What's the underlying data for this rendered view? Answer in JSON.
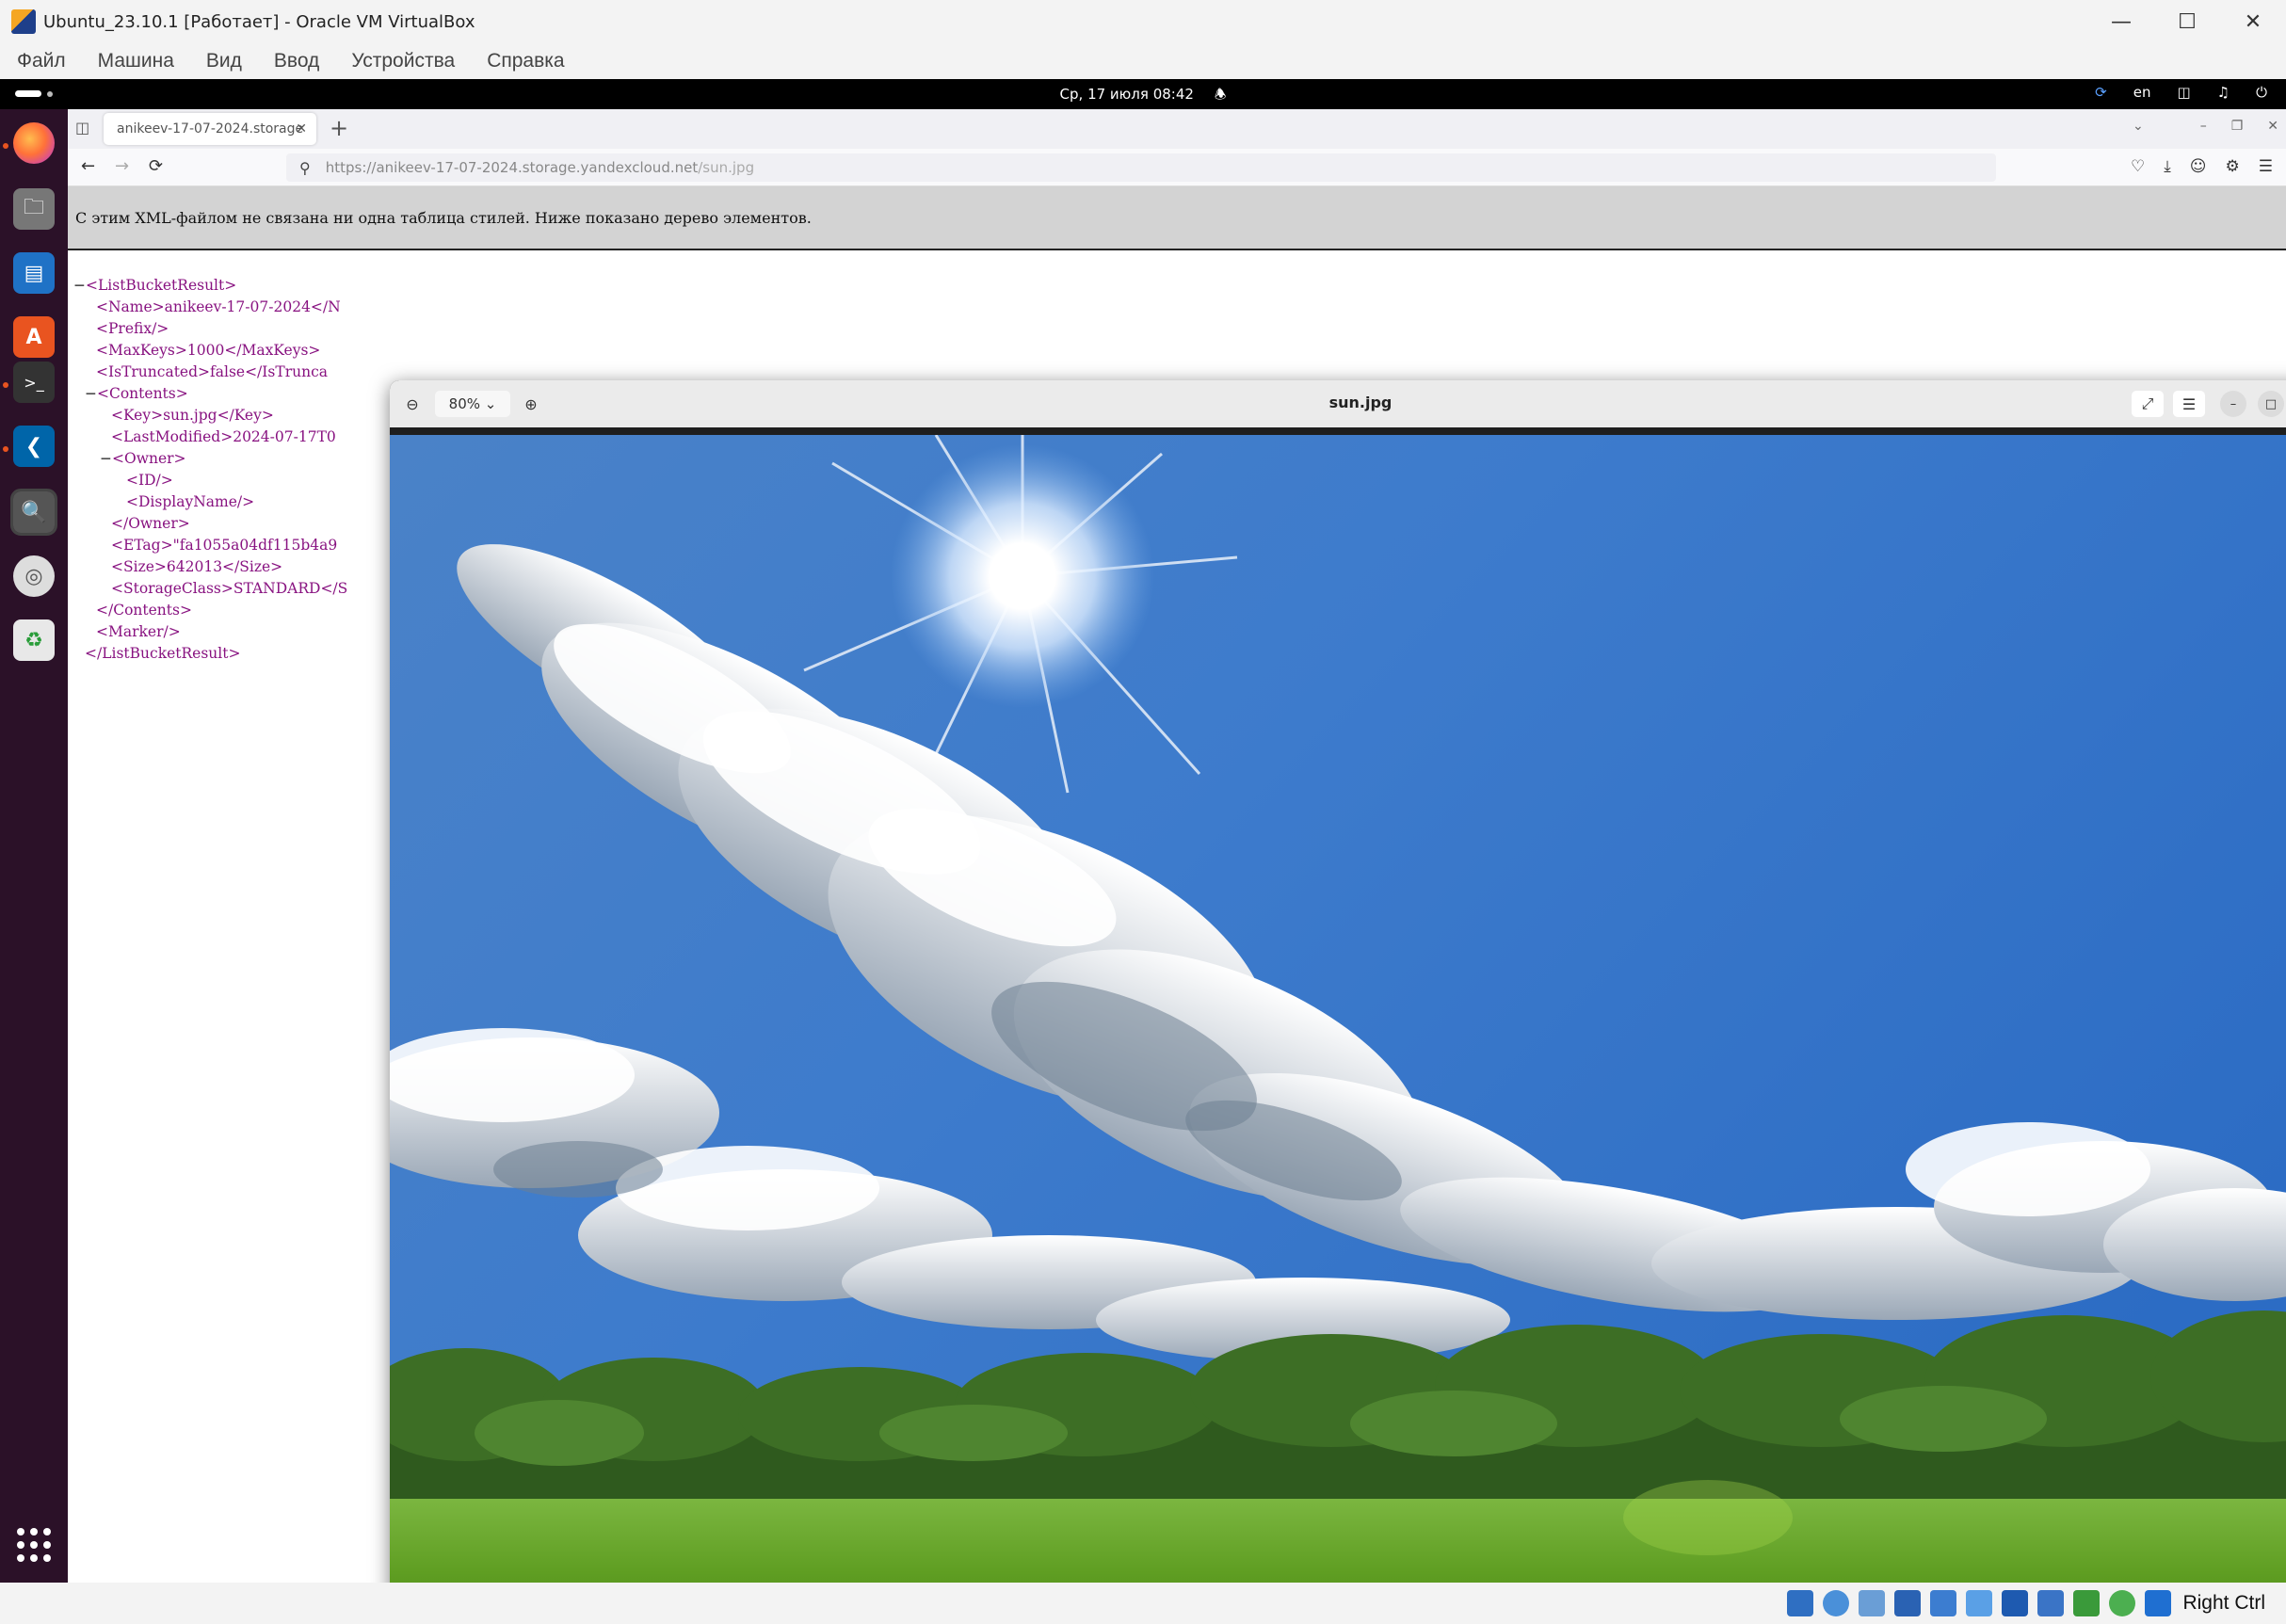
{
  "host_window": {
    "title": "Ubuntu_23.10.1 [Работает] - Oracle VM VirtualBox",
    "menu": [
      "Файл",
      "Машина",
      "Вид",
      "Ввод",
      "Устройства",
      "Справка"
    ],
    "host_key_label": "Right Ctrl"
  },
  "topbar": {
    "datetime": "Ср, 17 июля  08:42",
    "keyboard_layout": "en"
  },
  "browser": {
    "tab_title": "anikeev-17-07-2024.storage",
    "url_host": "https://anikeev-17-07-2024.storage.yandexcloud.net",
    "url_path": "/sun.jpg",
    "xml_notice": "С этим XML-файлом не связана ни одна таблица стилей. Ниже показано дерево элементов."
  },
  "xml_tree": [
    {
      "toggle": "−",
      "text": "<ListBucketResult>"
    },
    {
      "toggle": "",
      "text": "<Name>anikeev-17-07-2024</N"
    },
    {
      "toggle": "",
      "text": "<Prefix/>"
    },
    {
      "toggle": "",
      "text": "<MaxKeys>1000</MaxKeys>"
    },
    {
      "toggle": "",
      "text": "<IsTruncated>false</IsTrunca"
    },
    {
      "toggle": "−",
      "text": "<Contents>"
    },
    {
      "toggle": "",
      "text": "<Key>sun.jpg</Key>"
    },
    {
      "toggle": "",
      "text": "<LastModified>2024-07-17T0"
    },
    {
      "toggle": "−",
      "text": "<Owner>"
    },
    {
      "toggle": "",
      "text": "<ID/>"
    },
    {
      "toggle": "",
      "text": "<DisplayName/>"
    },
    {
      "toggle": "",
      "text": "</Owner>"
    },
    {
      "toggle": "",
      "text": "<ETag>\"fa1055a04df115b4a9"
    },
    {
      "toggle": "",
      "text": "<Size>642013</Size>"
    },
    {
      "toggle": "",
      "text": "<StorageClass>STANDARD</S"
    },
    {
      "toggle": "",
      "text": "</Contents>"
    },
    {
      "toggle": "",
      "text": "<Marker/>"
    },
    {
      "toggle": "",
      "text": "</ListBucketResult>"
    }
  ],
  "viewer": {
    "title": "sun.jpg",
    "zoom": "80%"
  },
  "icons": {
    "dock": [
      "firefox-icon",
      "files-icon",
      "writer-icon",
      "app-center-icon",
      "terminal-icon",
      "vscode-icon",
      "image-viewer-icon",
      "disc-icon",
      "trash-icon",
      "show-apps-icon"
    ]
  }
}
